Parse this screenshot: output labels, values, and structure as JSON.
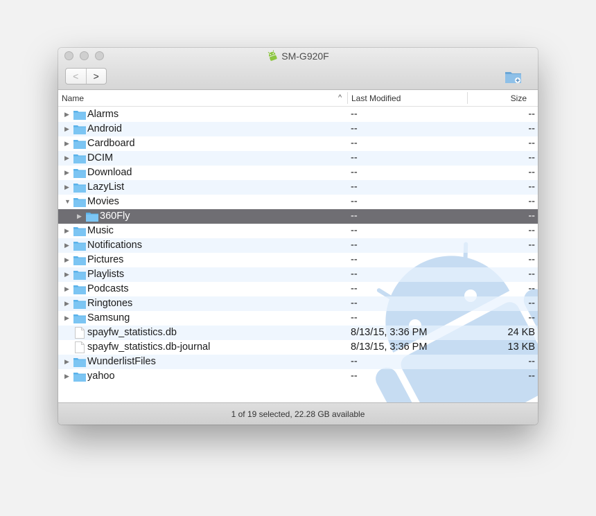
{
  "window": {
    "title": "SM-G920F",
    "nav": {
      "back_label": "<",
      "forward_label": ">"
    },
    "icons": {
      "title": "android-icon",
      "new_folder": "new-folder-icon"
    }
  },
  "columns": {
    "name": "Name",
    "modified": "Last Modified",
    "size": "Size",
    "sort_indicator": "^"
  },
  "files": [
    {
      "name": "Alarms",
      "type": "folder",
      "modified": "--",
      "size": "--",
      "state": "collapsed",
      "level": 0
    },
    {
      "name": "Android",
      "type": "folder",
      "modified": "--",
      "size": "--",
      "state": "collapsed",
      "level": 0
    },
    {
      "name": "Cardboard",
      "type": "folder",
      "modified": "--",
      "size": "--",
      "state": "collapsed",
      "level": 0
    },
    {
      "name": "DCIM",
      "type": "folder",
      "modified": "--",
      "size": "--",
      "state": "collapsed",
      "level": 0
    },
    {
      "name": "Download",
      "type": "folder",
      "modified": "--",
      "size": "--",
      "state": "collapsed",
      "level": 0
    },
    {
      "name": "LazyList",
      "type": "folder",
      "modified": "--",
      "size": "--",
      "state": "collapsed",
      "level": 0
    },
    {
      "name": "Movies",
      "type": "folder",
      "modified": "--",
      "size": "--",
      "state": "expanded",
      "level": 0
    },
    {
      "name": "360Fly",
      "type": "folder",
      "modified": "--",
      "size": "--",
      "state": "collapsed",
      "level": 1,
      "selected": true
    },
    {
      "name": "Music",
      "type": "folder",
      "modified": "--",
      "size": "--",
      "state": "collapsed",
      "level": 0
    },
    {
      "name": "Notifications",
      "type": "folder",
      "modified": "--",
      "size": "--",
      "state": "collapsed",
      "level": 0
    },
    {
      "name": "Pictures",
      "type": "folder",
      "modified": "--",
      "size": "--",
      "state": "collapsed",
      "level": 0
    },
    {
      "name": "Playlists",
      "type": "folder",
      "modified": "--",
      "size": "--",
      "state": "collapsed",
      "level": 0
    },
    {
      "name": "Podcasts",
      "type": "folder",
      "modified": "--",
      "size": "--",
      "state": "collapsed",
      "level": 0
    },
    {
      "name": "Ringtones",
      "type": "folder",
      "modified": "--",
      "size": "--",
      "state": "collapsed",
      "level": 0
    },
    {
      "name": "Samsung",
      "type": "folder",
      "modified": "--",
      "size": "--",
      "state": "collapsed",
      "level": 0
    },
    {
      "name": "spayfw_statistics.db",
      "type": "file",
      "modified": "8/13/15, 3:36 PM",
      "size": "24 KB",
      "level": 0
    },
    {
      "name": "spayfw_statistics.db-journal",
      "type": "file",
      "modified": "8/13/15, 3:36 PM",
      "size": "13 KB",
      "level": 0
    },
    {
      "name": "WunderlistFiles",
      "type": "folder",
      "modified": "--",
      "size": "--",
      "state": "collapsed",
      "level": 0
    },
    {
      "name": "yahoo",
      "type": "folder",
      "modified": "--",
      "size": "--",
      "state": "collapsed",
      "level": 0
    }
  ],
  "status": {
    "text": "1 of 19 selected, 22.28 GB available"
  },
  "colors": {
    "folder": "#5ab2ea",
    "selection": "#6f6e73",
    "alt_row": "#e8f2fd",
    "watermark": "#bdd6f0",
    "android_green": "#8cc63f"
  }
}
